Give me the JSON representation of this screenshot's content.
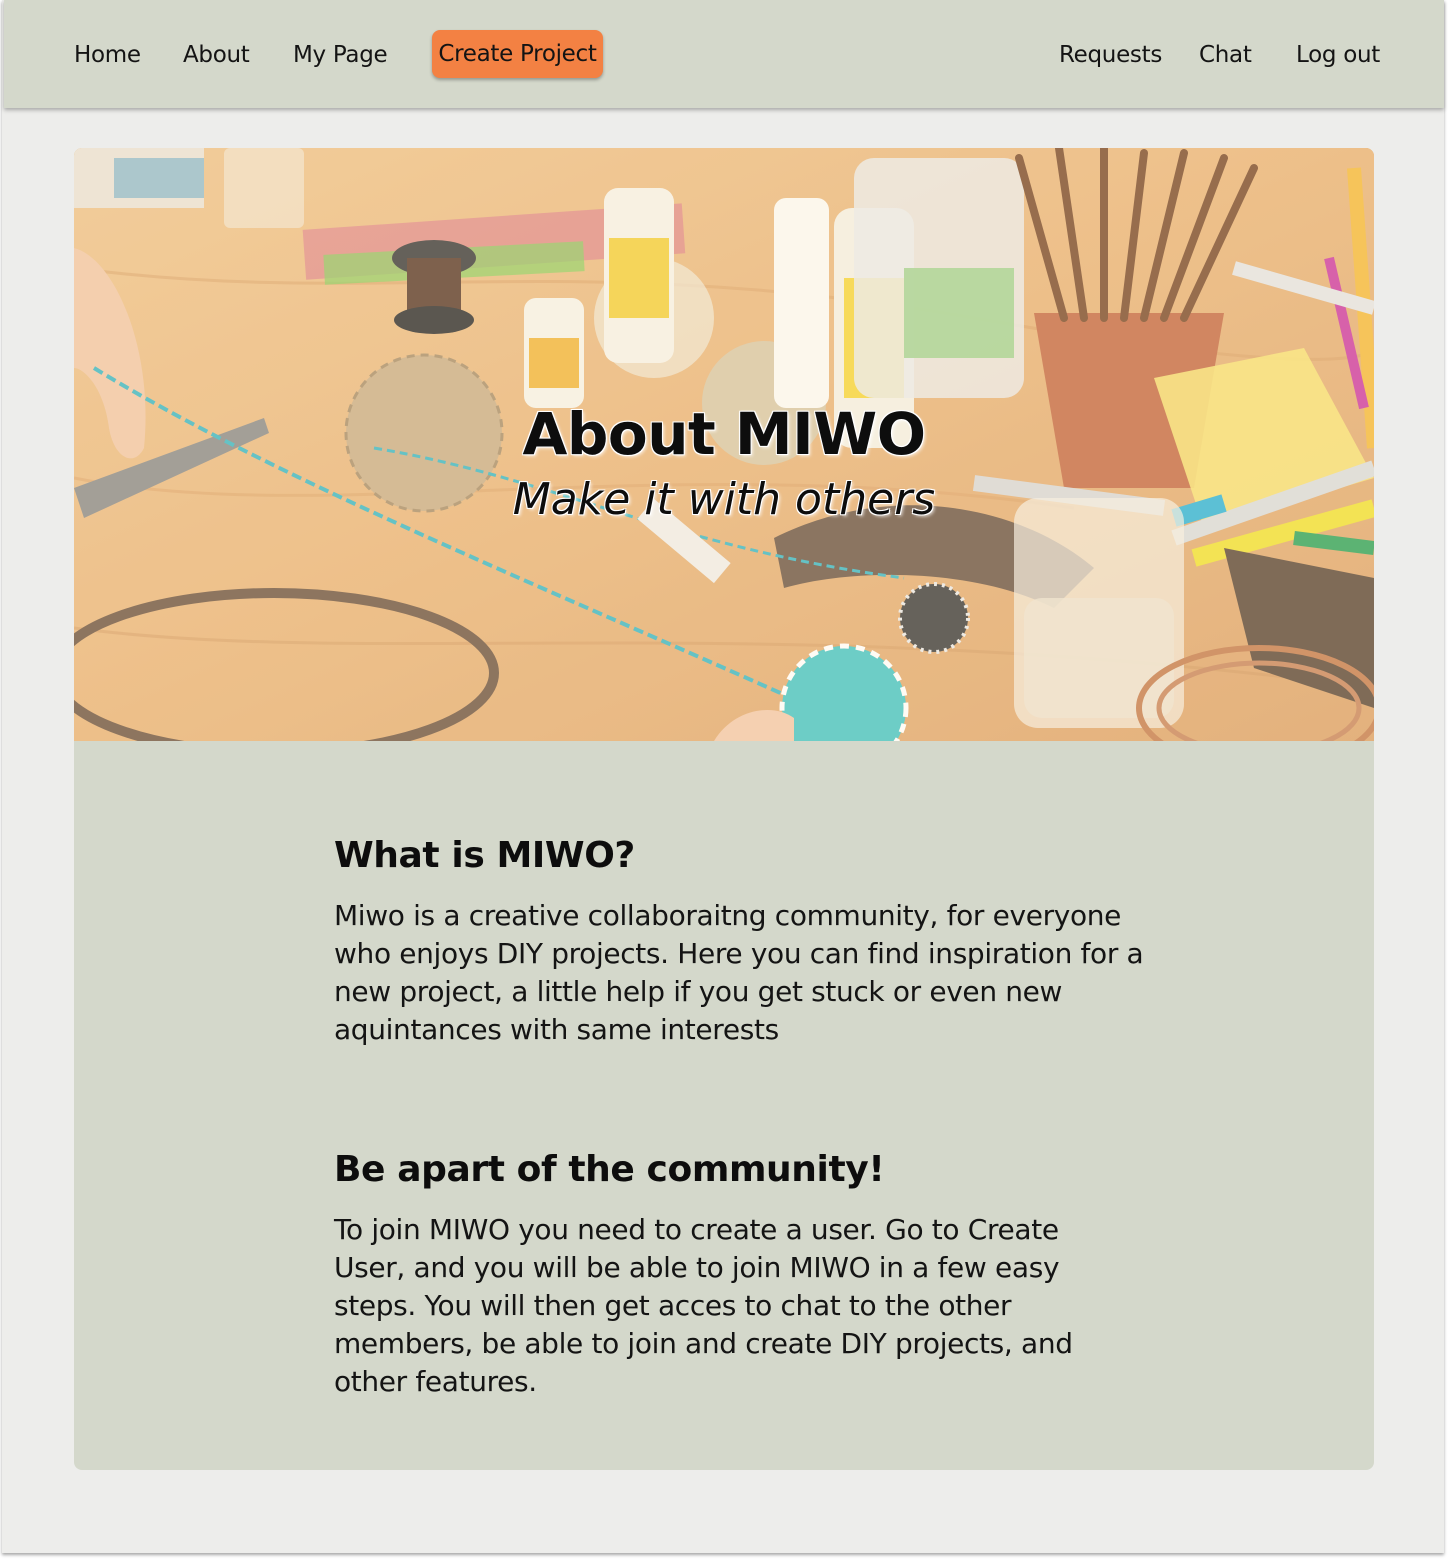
{
  "nav": {
    "left": [
      {
        "label": "Home"
      },
      {
        "label": "About"
      },
      {
        "label": "My Page"
      }
    ],
    "cta_label": "Create Project",
    "right": [
      {
        "label": "Requests"
      },
      {
        "label": "Chat"
      },
      {
        "label": "Log out"
      }
    ]
  },
  "hero": {
    "title": "About MIWO",
    "subtitle": "Make it with others"
  },
  "sections": [
    {
      "heading": "What is MIWO?",
      "body": "Miwo is a creative collaboraitng community, for everyone who enjoys DIY projects. Here you can find inspiration for a new project, a little help if you get stuck or even new aquintances with same interests"
    },
    {
      "heading": "Be apart of the community!",
      "body": "To join MIWO you need to create a user. Go to Create User, and you will be able to join MIWO in a few easy steps. You will then get acces to chat to the other members,  be able to join and create DIY projects, and other features."
    }
  ],
  "colors": {
    "nav_bg": "#d4d8cb",
    "cta_bg": "#f38143",
    "page_bg": "#ededeb",
    "card_bg": "#d4d8cb"
  }
}
